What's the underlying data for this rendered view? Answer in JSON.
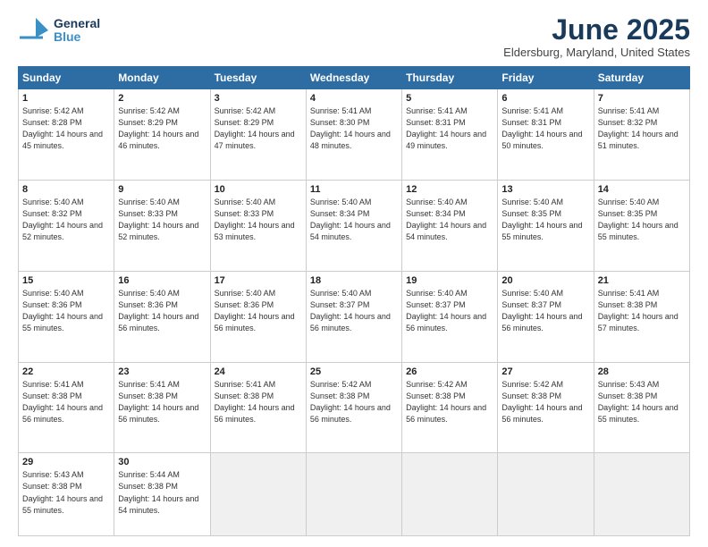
{
  "header": {
    "logo_general": "General",
    "logo_blue": "Blue",
    "month_title": "June 2025",
    "location": "Eldersburg, Maryland, United States"
  },
  "days_of_week": [
    "Sunday",
    "Monday",
    "Tuesday",
    "Wednesday",
    "Thursday",
    "Friday",
    "Saturday"
  ],
  "weeks": [
    [
      {
        "day": "1",
        "sunrise": "5:42 AM",
        "sunset": "8:28 PM",
        "daylight": "14 hours and 45 minutes."
      },
      {
        "day": "2",
        "sunrise": "5:42 AM",
        "sunset": "8:29 PM",
        "daylight": "14 hours and 46 minutes."
      },
      {
        "day": "3",
        "sunrise": "5:42 AM",
        "sunset": "8:29 PM",
        "daylight": "14 hours and 47 minutes."
      },
      {
        "day": "4",
        "sunrise": "5:41 AM",
        "sunset": "8:30 PM",
        "daylight": "14 hours and 48 minutes."
      },
      {
        "day": "5",
        "sunrise": "5:41 AM",
        "sunset": "8:31 PM",
        "daylight": "14 hours and 49 minutes."
      },
      {
        "day": "6",
        "sunrise": "5:41 AM",
        "sunset": "8:31 PM",
        "daylight": "14 hours and 50 minutes."
      },
      {
        "day": "7",
        "sunrise": "5:41 AM",
        "sunset": "8:32 PM",
        "daylight": "14 hours and 51 minutes."
      }
    ],
    [
      {
        "day": "8",
        "sunrise": "5:40 AM",
        "sunset": "8:32 PM",
        "daylight": "14 hours and 52 minutes."
      },
      {
        "day": "9",
        "sunrise": "5:40 AM",
        "sunset": "8:33 PM",
        "daylight": "14 hours and 52 minutes."
      },
      {
        "day": "10",
        "sunrise": "5:40 AM",
        "sunset": "8:33 PM",
        "daylight": "14 hours and 53 minutes."
      },
      {
        "day": "11",
        "sunrise": "5:40 AM",
        "sunset": "8:34 PM",
        "daylight": "14 hours and 54 minutes."
      },
      {
        "day": "12",
        "sunrise": "5:40 AM",
        "sunset": "8:34 PM",
        "daylight": "14 hours and 54 minutes."
      },
      {
        "day": "13",
        "sunrise": "5:40 AM",
        "sunset": "8:35 PM",
        "daylight": "14 hours and 55 minutes."
      },
      {
        "day": "14",
        "sunrise": "5:40 AM",
        "sunset": "8:35 PM",
        "daylight": "14 hours and 55 minutes."
      }
    ],
    [
      {
        "day": "15",
        "sunrise": "5:40 AM",
        "sunset": "8:36 PM",
        "daylight": "14 hours and 55 minutes."
      },
      {
        "day": "16",
        "sunrise": "5:40 AM",
        "sunset": "8:36 PM",
        "daylight": "14 hours and 56 minutes."
      },
      {
        "day": "17",
        "sunrise": "5:40 AM",
        "sunset": "8:36 PM",
        "daylight": "14 hours and 56 minutes."
      },
      {
        "day": "18",
        "sunrise": "5:40 AM",
        "sunset": "8:37 PM",
        "daylight": "14 hours and 56 minutes."
      },
      {
        "day": "19",
        "sunrise": "5:40 AM",
        "sunset": "8:37 PM",
        "daylight": "14 hours and 56 minutes."
      },
      {
        "day": "20",
        "sunrise": "5:40 AM",
        "sunset": "8:37 PM",
        "daylight": "14 hours and 56 minutes."
      },
      {
        "day": "21",
        "sunrise": "5:41 AM",
        "sunset": "8:38 PM",
        "daylight": "14 hours and 57 minutes."
      }
    ],
    [
      {
        "day": "22",
        "sunrise": "5:41 AM",
        "sunset": "8:38 PM",
        "daylight": "14 hours and 56 minutes."
      },
      {
        "day": "23",
        "sunrise": "5:41 AM",
        "sunset": "8:38 PM",
        "daylight": "14 hours and 56 minutes."
      },
      {
        "day": "24",
        "sunrise": "5:41 AM",
        "sunset": "8:38 PM",
        "daylight": "14 hours and 56 minutes."
      },
      {
        "day": "25",
        "sunrise": "5:42 AM",
        "sunset": "8:38 PM",
        "daylight": "14 hours and 56 minutes."
      },
      {
        "day": "26",
        "sunrise": "5:42 AM",
        "sunset": "8:38 PM",
        "daylight": "14 hours and 56 minutes."
      },
      {
        "day": "27",
        "sunrise": "5:42 AM",
        "sunset": "8:38 PM",
        "daylight": "14 hours and 56 minutes."
      },
      {
        "day": "28",
        "sunrise": "5:43 AM",
        "sunset": "8:38 PM",
        "daylight": "14 hours and 55 minutes."
      }
    ],
    [
      {
        "day": "29",
        "sunrise": "5:43 AM",
        "sunset": "8:38 PM",
        "daylight": "14 hours and 55 minutes."
      },
      {
        "day": "30",
        "sunrise": "5:44 AM",
        "sunset": "8:38 PM",
        "daylight": "14 hours and 54 minutes."
      },
      null,
      null,
      null,
      null,
      null
    ]
  ]
}
